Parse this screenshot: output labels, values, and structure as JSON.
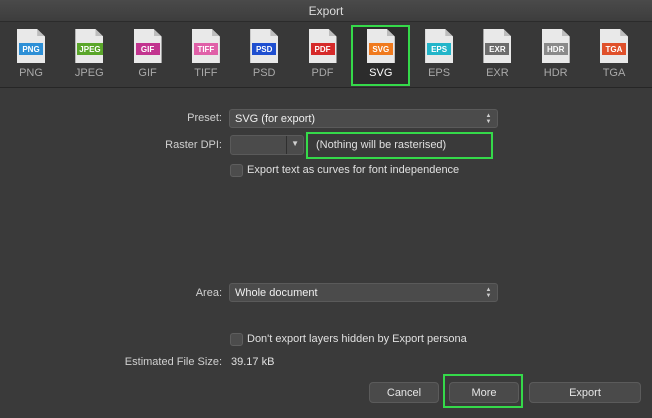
{
  "window": {
    "title": "Export"
  },
  "formats": [
    {
      "tag": "PNG",
      "label": "PNG",
      "color": "#2d8fd6"
    },
    {
      "tag": "JPEG",
      "label": "JPEG",
      "color": "#5aa62a"
    },
    {
      "tag": "GIF",
      "label": "GIF",
      "color": "#c2348f"
    },
    {
      "tag": "TIFF",
      "label": "TIFF",
      "color": "#e060a8"
    },
    {
      "tag": "PSD",
      "label": "PSD",
      "color": "#1f4fd0"
    },
    {
      "tag": "PDF",
      "label": "PDF",
      "color": "#d62a2a"
    },
    {
      "tag": "SVG",
      "label": "SVG",
      "color": "#f07a1e"
    },
    {
      "tag": "EPS",
      "label": "EPS",
      "color": "#22b5c9"
    },
    {
      "tag": "EXR",
      "label": "EXR",
      "color": "#6d6d6d"
    },
    {
      "tag": "HDR",
      "label": "HDR",
      "color": "#8a8a8a"
    },
    {
      "tag": "TGA",
      "label": "TGA",
      "color": "#e0502a"
    }
  ],
  "selected_format": "SVG",
  "settings": {
    "preset_label": "Preset:",
    "preset_value": "SVG (for export)",
    "raster_dpi_label": "Raster DPI:",
    "raster_dpi_value": "",
    "raster_note": "(Nothing will be rasterised)",
    "text_curves_label": "Export text as curves for font independence",
    "text_curves_checked": false,
    "area_label": "Area:",
    "area_value": "Whole document",
    "hidden_layers_label": "Don't export layers hidden by Export persona",
    "hidden_layers_checked": false,
    "file_size_label": "Estimated File Size:",
    "file_size_value": "39.17 kB"
  },
  "buttons": {
    "cancel": "Cancel",
    "more": "More",
    "export": "Export"
  },
  "colors": {
    "highlight": "#35d94a",
    "background": "#3a3a3a"
  }
}
